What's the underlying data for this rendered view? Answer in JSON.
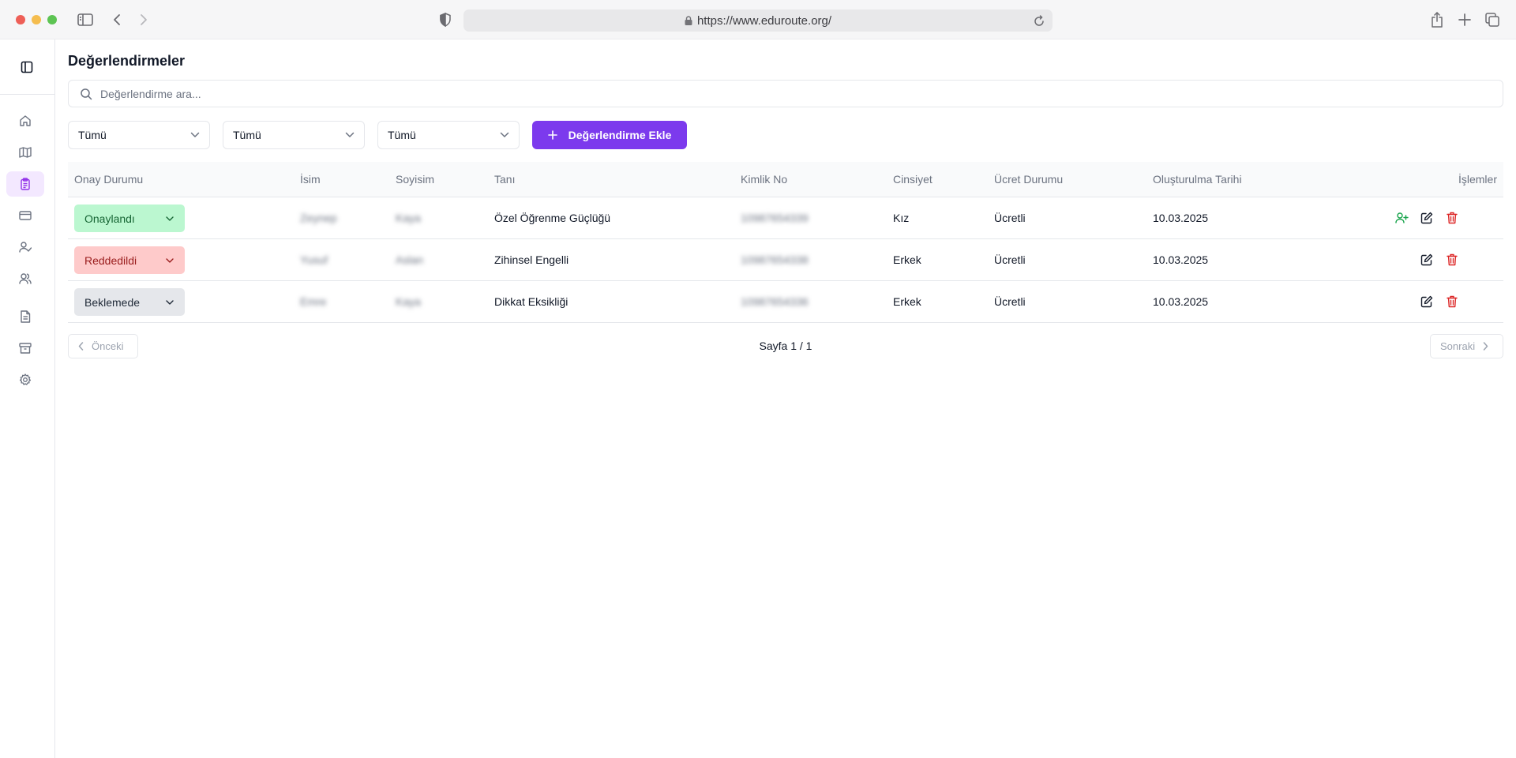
{
  "browser": {
    "url": "https://www.eduroute.org/"
  },
  "sidebar": {
    "items": [
      {
        "icon": "home-icon",
        "active": false
      },
      {
        "icon": "map-icon",
        "active": false
      },
      {
        "icon": "clipboard-icon",
        "active": true
      },
      {
        "icon": "credit-card-icon",
        "active": false
      },
      {
        "icon": "user-check-icon",
        "active": false
      },
      {
        "icon": "users-icon",
        "active": false
      },
      {
        "icon": "document-icon",
        "active": false
      },
      {
        "icon": "archive-icon",
        "active": false
      },
      {
        "icon": "settings-icon",
        "active": false
      }
    ]
  },
  "page": {
    "title": "Değerlendirmeler",
    "search_placeholder": "Değerlendirme ara...",
    "filters": [
      "Tümü",
      "Tümü",
      "Tümü"
    ],
    "add_button": "Değerlendirme Ekle"
  },
  "table": {
    "headers": {
      "status": "Onay Durumu",
      "first_name": "İsim",
      "last_name": "Soyisim",
      "diagnosis": "Tanı",
      "id_no": "Kimlik No",
      "gender": "Cinsiyet",
      "fee_status": "Ücret Durumu",
      "created": "Oluşturulma Tarihi",
      "actions": "İşlemler"
    },
    "rows": [
      {
        "status": "Onaylandı",
        "first_name": "Zeynep",
        "last_name": "Kaya",
        "diagnosis": "Özel Öğrenme Güçlüğü",
        "id_no": "10987654339",
        "gender": "Kız",
        "fee_status": "Ücretli",
        "created": "10.03.2025"
      },
      {
        "status": "Reddedildi",
        "first_name": "Yusuf",
        "last_name": "Aslan",
        "diagnosis": "Zihinsel Engelli",
        "id_no": "10987654338",
        "gender": "Erkek",
        "fee_status": "Ücretli",
        "created": "10.03.2025"
      },
      {
        "status": "Beklemede",
        "first_name": "Emre",
        "last_name": "Kaya",
        "diagnosis": "Dikkat Eksikliği",
        "id_no": "10987654336",
        "gender": "Erkek",
        "fee_status": "Ücretli",
        "created": "10.03.2025"
      }
    ]
  },
  "pagination": {
    "prev": "Önceki",
    "info": "Sayfa 1 / 1",
    "next": "Sonraki"
  },
  "colors": {
    "accent": "#7c3aed",
    "approved_bg": "#bbf7d0",
    "rejected_bg": "#fecaca",
    "pending_bg": "#e5e7eb"
  }
}
